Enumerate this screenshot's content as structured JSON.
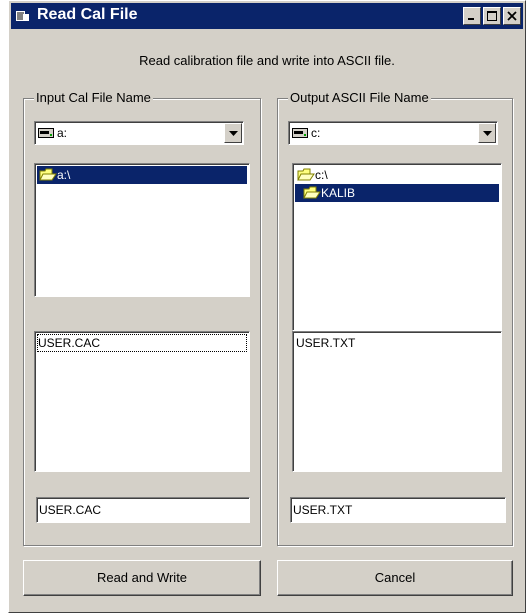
{
  "window": {
    "title": "Read Cal File",
    "header_text": "Read calibration file and write into ASCII file."
  },
  "input": {
    "legend": "Input Cal File Name",
    "drive": "a:",
    "directories": [
      {
        "label": "a:\\",
        "selected": true
      }
    ],
    "files": [
      "USER.CAC"
    ],
    "filename": "USER.CAC"
  },
  "output": {
    "legend": "Output ASCII File Name",
    "drive": "c:",
    "directories": [
      {
        "label": "c:\\",
        "selected": false
      },
      {
        "label": "KALIB",
        "selected": true
      }
    ],
    "files": [
      "USER.TXT"
    ],
    "filename": "USER.TXT"
  },
  "buttons": {
    "read_write": "Read and Write",
    "cancel": "Cancel"
  },
  "colors": {
    "title_bar": "#0a246a",
    "selection": "#0a246a",
    "face": "#d4d0c8"
  },
  "icons": {
    "app": "app-icon",
    "drive": "drive-icon",
    "folder": "open-folder-icon",
    "dropdown": "chevron-down-icon"
  }
}
